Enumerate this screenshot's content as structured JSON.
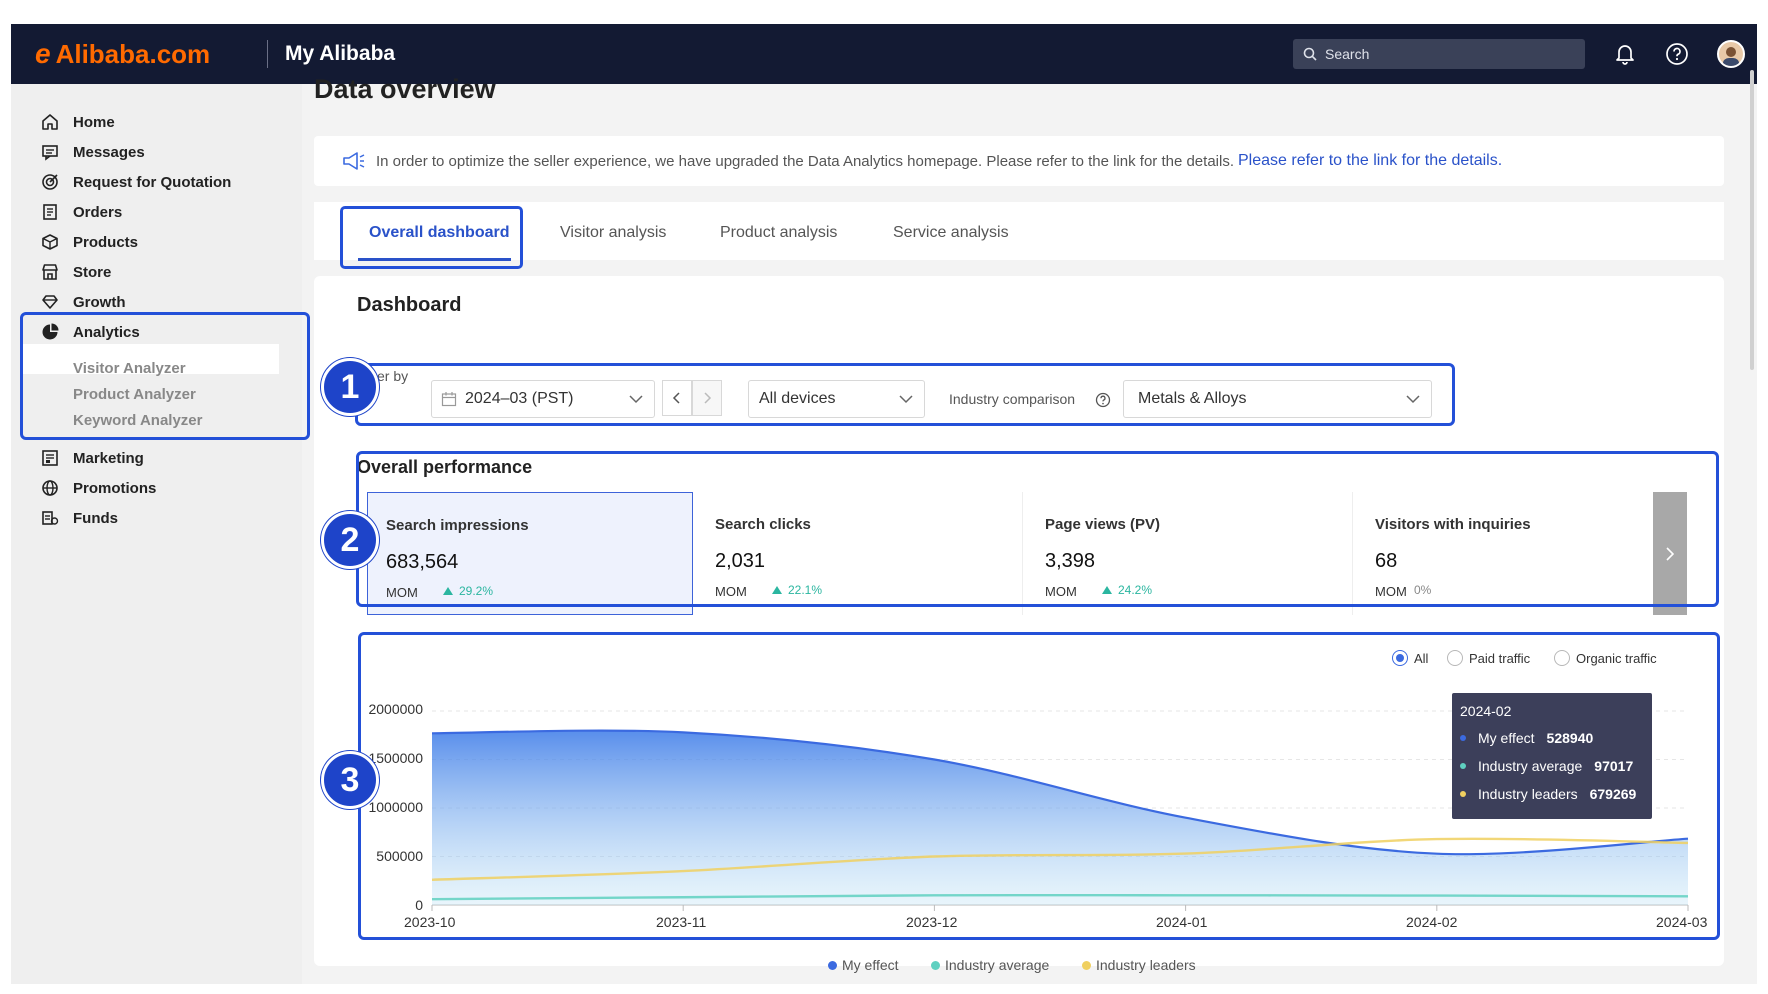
{
  "header": {
    "logo_text": "Alibaba.com",
    "app_title": "My Alibaba",
    "search_placeholder": "Search"
  },
  "sidebar": {
    "items": [
      {
        "label": "Home",
        "icon": "home-icon"
      },
      {
        "label": "Messages",
        "icon": "message-icon"
      },
      {
        "label": "Request for Quotation",
        "icon": "quotation-icon"
      },
      {
        "label": "Orders",
        "icon": "orders-icon"
      },
      {
        "label": "Products",
        "icon": "products-icon"
      },
      {
        "label": "Store",
        "icon": "store-icon"
      },
      {
        "label": "Growth",
        "icon": "growth-icon"
      },
      {
        "label": "Analytics",
        "icon": "analytics-icon",
        "active": true
      },
      {
        "label": "Marketing",
        "icon": "marketing-icon"
      },
      {
        "label": "Promotions",
        "icon": "promotions-icon"
      },
      {
        "label": "Funds",
        "icon": "funds-icon"
      }
    ],
    "analytics_sub": [
      "Visitor Analyzer",
      "Product Analyzer",
      "Keyword Analyzer"
    ]
  },
  "page": {
    "title": "Data overview",
    "notice_text": "In order to optimize the seller experience, we have upgraded the Data Analytics homepage. Please refer to the link for the details.",
    "notice_link": "Please refer to the link for the details."
  },
  "tabs": [
    "Overall dashboard",
    "Visitor analysis",
    "Product analysis",
    "Service analysis"
  ],
  "dashboard": {
    "title": "Dashboard",
    "filter_label": "lter by",
    "period": "2024–03 (PST)",
    "devices": "All devices",
    "industry_label": "Industry comparison",
    "industry": "Metals & Alloys"
  },
  "performance": {
    "title": "Overall performance",
    "mom_label": "MOM",
    "metrics": [
      {
        "name": "Search impressions",
        "value": "683,564",
        "change": "29.2%",
        "trend": "up"
      },
      {
        "name": "Search clicks",
        "value": "2,031",
        "change": "22.1%",
        "trend": "up"
      },
      {
        "name": "Page views (PV)",
        "value": "3,398",
        "change": "24.2%",
        "trend": "up"
      },
      {
        "name": "Visitors with inquiries",
        "value": "68",
        "change": "0%",
        "trend": "flat"
      }
    ]
  },
  "traffic_filter": {
    "options": [
      "All",
      "Paid traffic",
      "Organic traffic"
    ],
    "selected": "All"
  },
  "tooltip": {
    "title": "2024-02",
    "rows": [
      {
        "name": "My effect",
        "value": "528940"
      },
      {
        "name": "Industry average",
        "value": "97017"
      },
      {
        "name": "Industry leaders",
        "value": "679269"
      }
    ]
  },
  "badges": [
    "1",
    "2",
    "3"
  ],
  "colors": {
    "accent": "#2a52c9",
    "annotation": "#2350d8",
    "my_effect": "#3b6ae0",
    "industry_average": "#5fd0c0",
    "industry_leaders": "#f0d060",
    "up": "#2bb6a0"
  },
  "chart_data": {
    "type": "area",
    "x": [
      "2023-10",
      "2023-11",
      "2023-12",
      "2024-01",
      "2024-02",
      "2024-03"
    ],
    "ylim": [
      0,
      2000000
    ],
    "yticks": [
      "2000000",
      "1500000",
      "1000000",
      "500000",
      "0"
    ],
    "grid": true,
    "legend_position": "bottom",
    "series": [
      {
        "name": "My effect",
        "values": [
          1770000,
          1780000,
          1500000,
          900000,
          528940,
          683564
        ],
        "color": "#3b6ae0"
      },
      {
        "name": "Industry average",
        "values": [
          60000,
          80000,
          100000,
          100000,
          97017,
          90000
        ],
        "color": "#5fd0c0"
      },
      {
        "name": "Industry leaders",
        "values": [
          260000,
          350000,
          500000,
          530000,
          679269,
          640000
        ],
        "color": "#f0d060"
      }
    ]
  }
}
